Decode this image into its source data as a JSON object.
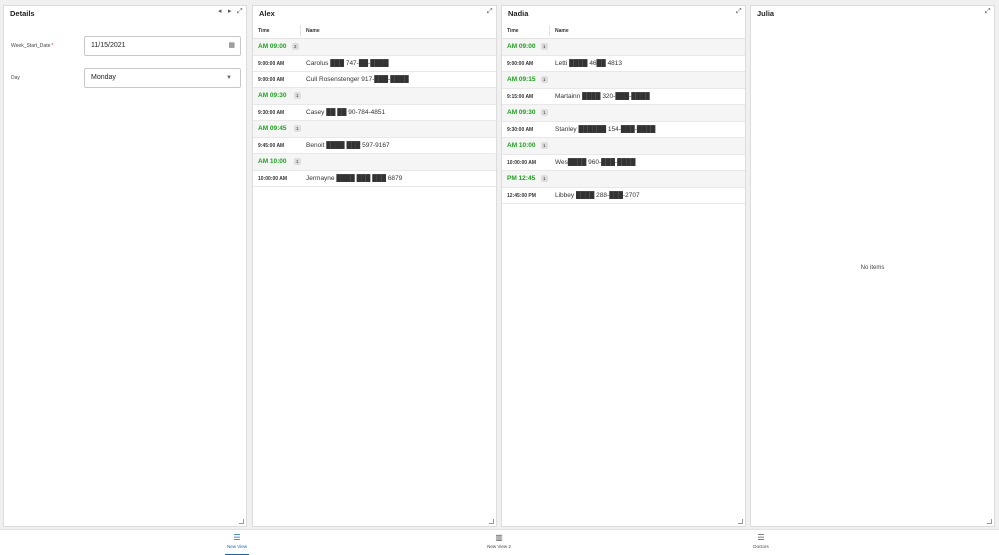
{
  "details": {
    "title": "Details",
    "nav_prev_icon": "chevron-left-icon",
    "nav_next_icon": "chevron-right-icon",
    "expand_icon": "expand-icon",
    "week_start_label": "Week_Start_Date",
    "week_start_required": "*",
    "week_start_value": "11/15/2021",
    "day_label": "Day",
    "day_value": "Monday"
  },
  "columns": {
    "time": "Time",
    "name": "Name"
  },
  "alex": {
    "title": "Alex",
    "groups": [
      {
        "label": "AM 09:00",
        "count": "2",
        "rows": [
          {
            "time": "9:00:00 AM",
            "name": "Carolus ███ 747-██-████"
          },
          {
            "time": "9:00:00 AM",
            "name": "Cull Rosenstenger 917-███-████"
          }
        ]
      },
      {
        "label": "AM 09:30",
        "count": "1",
        "rows": [
          {
            "time": "9:30:00 AM",
            "name": "Casey ██ ██ 90-784-4851"
          }
        ]
      },
      {
        "label": "AM 09:45",
        "count": "1",
        "rows": [
          {
            "time": "9:45:00 AM",
            "name": "Benoit ████ ███ 597-9167"
          }
        ]
      },
      {
        "label": "AM 10:00",
        "count": "1",
        "rows": [
          {
            "time": "10:00:00 AM",
            "name": "Jermayne ████ ███ ███ 6879"
          }
        ]
      }
    ]
  },
  "nadia": {
    "title": "Nadia",
    "groups": [
      {
        "label": "AM 09:00",
        "count": "1",
        "rows": [
          {
            "time": "9:00:00 AM",
            "name": "Letti ████ 46██ 4813"
          }
        ]
      },
      {
        "label": "AM 09:15",
        "count": "1",
        "rows": [
          {
            "time": "9:15:00 AM",
            "name": "Martainn ████ 320-███-████"
          }
        ]
      },
      {
        "label": "AM 09:30",
        "count": "1",
        "rows": [
          {
            "time": "9:30:00 AM",
            "name": "Stanley ██████ 154-███-████"
          }
        ]
      },
      {
        "label": "AM 10:00",
        "count": "1",
        "rows": [
          {
            "time": "10:00:00 AM",
            "name": "Wes████ 960-███-████"
          }
        ]
      },
      {
        "label": "PM 12:45",
        "count": "1",
        "rows": [
          {
            "time": "12:45:00 PM",
            "name": "Libbey ████ 288-███-2707"
          }
        ]
      }
    ]
  },
  "julia": {
    "title": "Julia",
    "empty_text": "No items"
  },
  "bottom_nav": [
    {
      "label": "New View",
      "icon": "list-icon"
    },
    {
      "label": "New View 2",
      "icon": "bar-chart-icon"
    },
    {
      "label": "Doctors",
      "icon": "list-icon"
    }
  ],
  "colors": {
    "accent": "#1565c0",
    "group_time": "#1aa51a"
  }
}
